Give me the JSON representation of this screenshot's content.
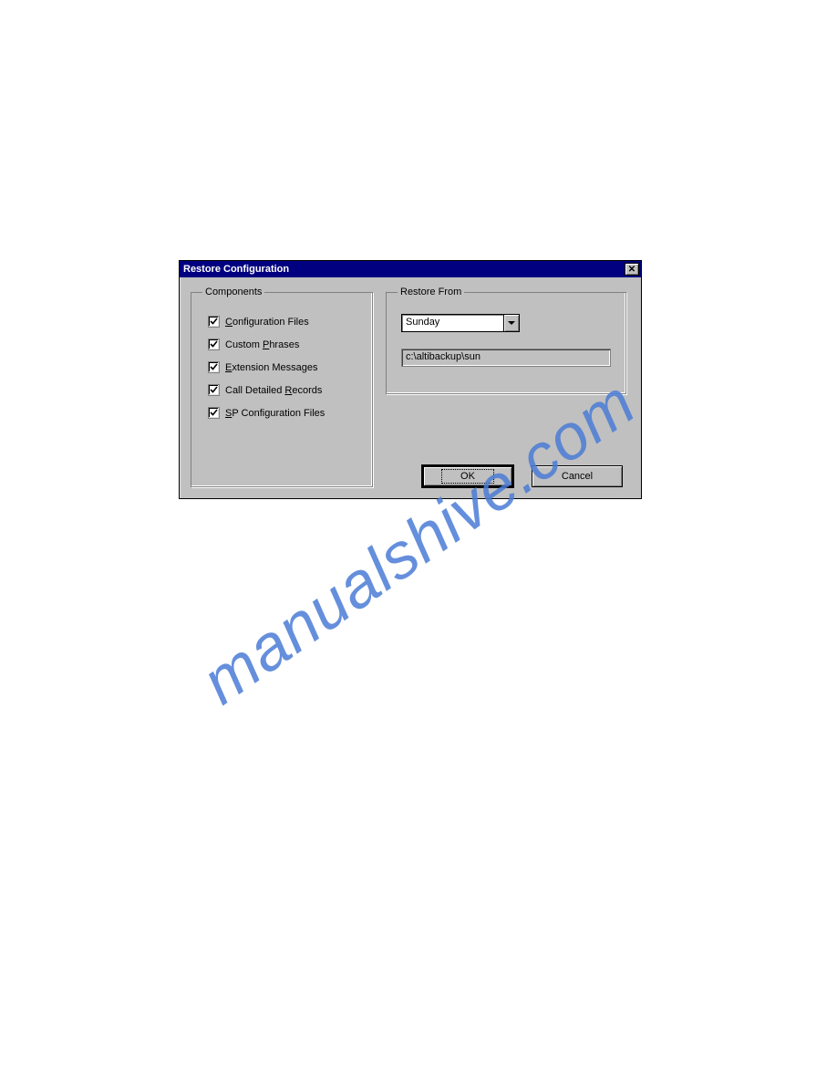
{
  "dialog": {
    "title": "Restore Configuration",
    "components": {
      "legend": "Components",
      "items": [
        {
          "checked": true,
          "prefix": "",
          "ul": "C",
          "suffix": "onfiguration Files"
        },
        {
          "checked": true,
          "prefix": "Custom ",
          "ul": "P",
          "suffix": "hrases"
        },
        {
          "checked": true,
          "prefix": "",
          "ul": "E",
          "suffix": "xtension Messages"
        },
        {
          "checked": true,
          "prefix": "Call Detailed ",
          "ul": "R",
          "suffix": "ecords"
        },
        {
          "checked": true,
          "prefix": "",
          "ul": "S",
          "suffix": "P Configuration Files"
        }
      ]
    },
    "restore": {
      "legend": "Restore From",
      "day": "Sunday",
      "path": "c:\\altibackup\\sun"
    },
    "buttons": {
      "ok": "OK",
      "cancel": "Cancel"
    }
  },
  "watermark": "manualshive.com"
}
